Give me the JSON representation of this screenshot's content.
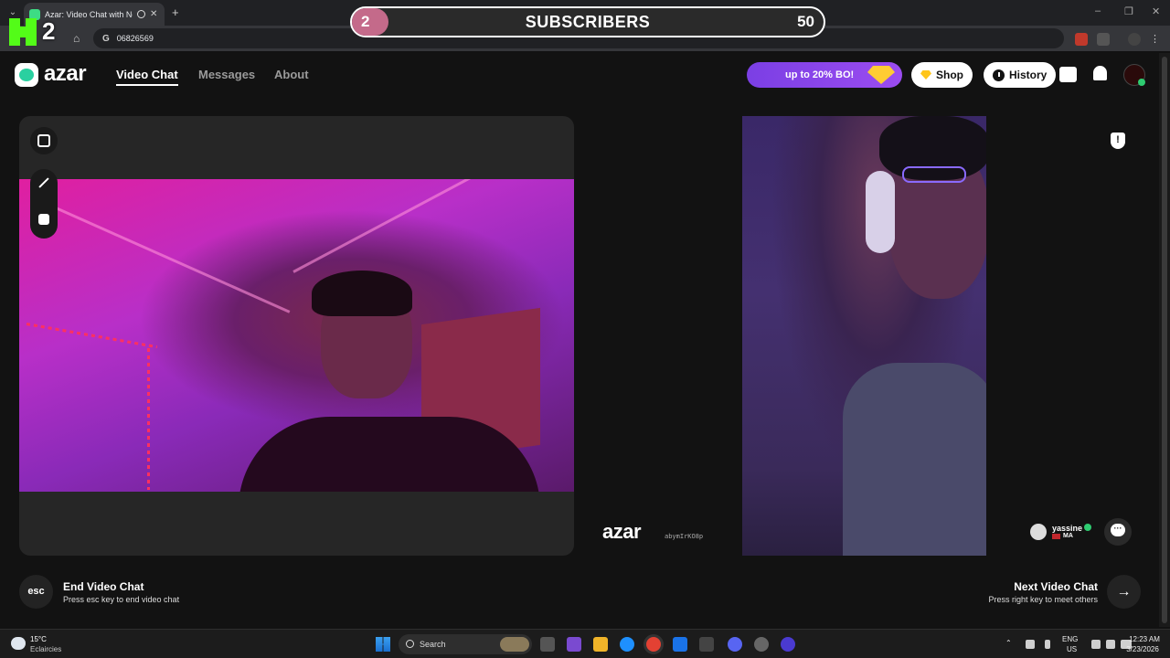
{
  "browser": {
    "tab_title": "Azar: Video Chat with New",
    "new_tab": "+",
    "url": "06826569"
  },
  "overlay": {
    "kick_count": "2",
    "subscribers_current": "2",
    "subscribers_label": "SUBSCRIBERS",
    "subscribers_goal": "50",
    "subscribers_progress": 0.04
  },
  "app": {
    "logo": "azar",
    "nav": {
      "video_chat": "Video Chat",
      "messages": "Messages",
      "about": "About"
    },
    "promo": "up to 20% BO!",
    "shop": "Shop",
    "history": "History"
  },
  "remote": {
    "watermark_logo": "azar",
    "watermark_code": "abymIrKO8p",
    "peer_name": "yassine",
    "peer_country": "MA"
  },
  "controls": {
    "esc_key": "esc",
    "end_title": "End Video Chat",
    "end_sub": "Press esc key to end video chat",
    "next_title": "Next Video Chat",
    "next_sub": "Press right key to meet others"
  },
  "taskbar": {
    "temp": "15°C",
    "weather": "Eclaircies",
    "search": "Search",
    "lang_top": "ENG",
    "lang_bottom": "US",
    "time": "12:23 AM",
    "date": "3/23/2026"
  },
  "colors": {
    "accent_purple": "#7b3fe4",
    "kick_green": "#53fc18",
    "online_green": "#2ecc71"
  }
}
